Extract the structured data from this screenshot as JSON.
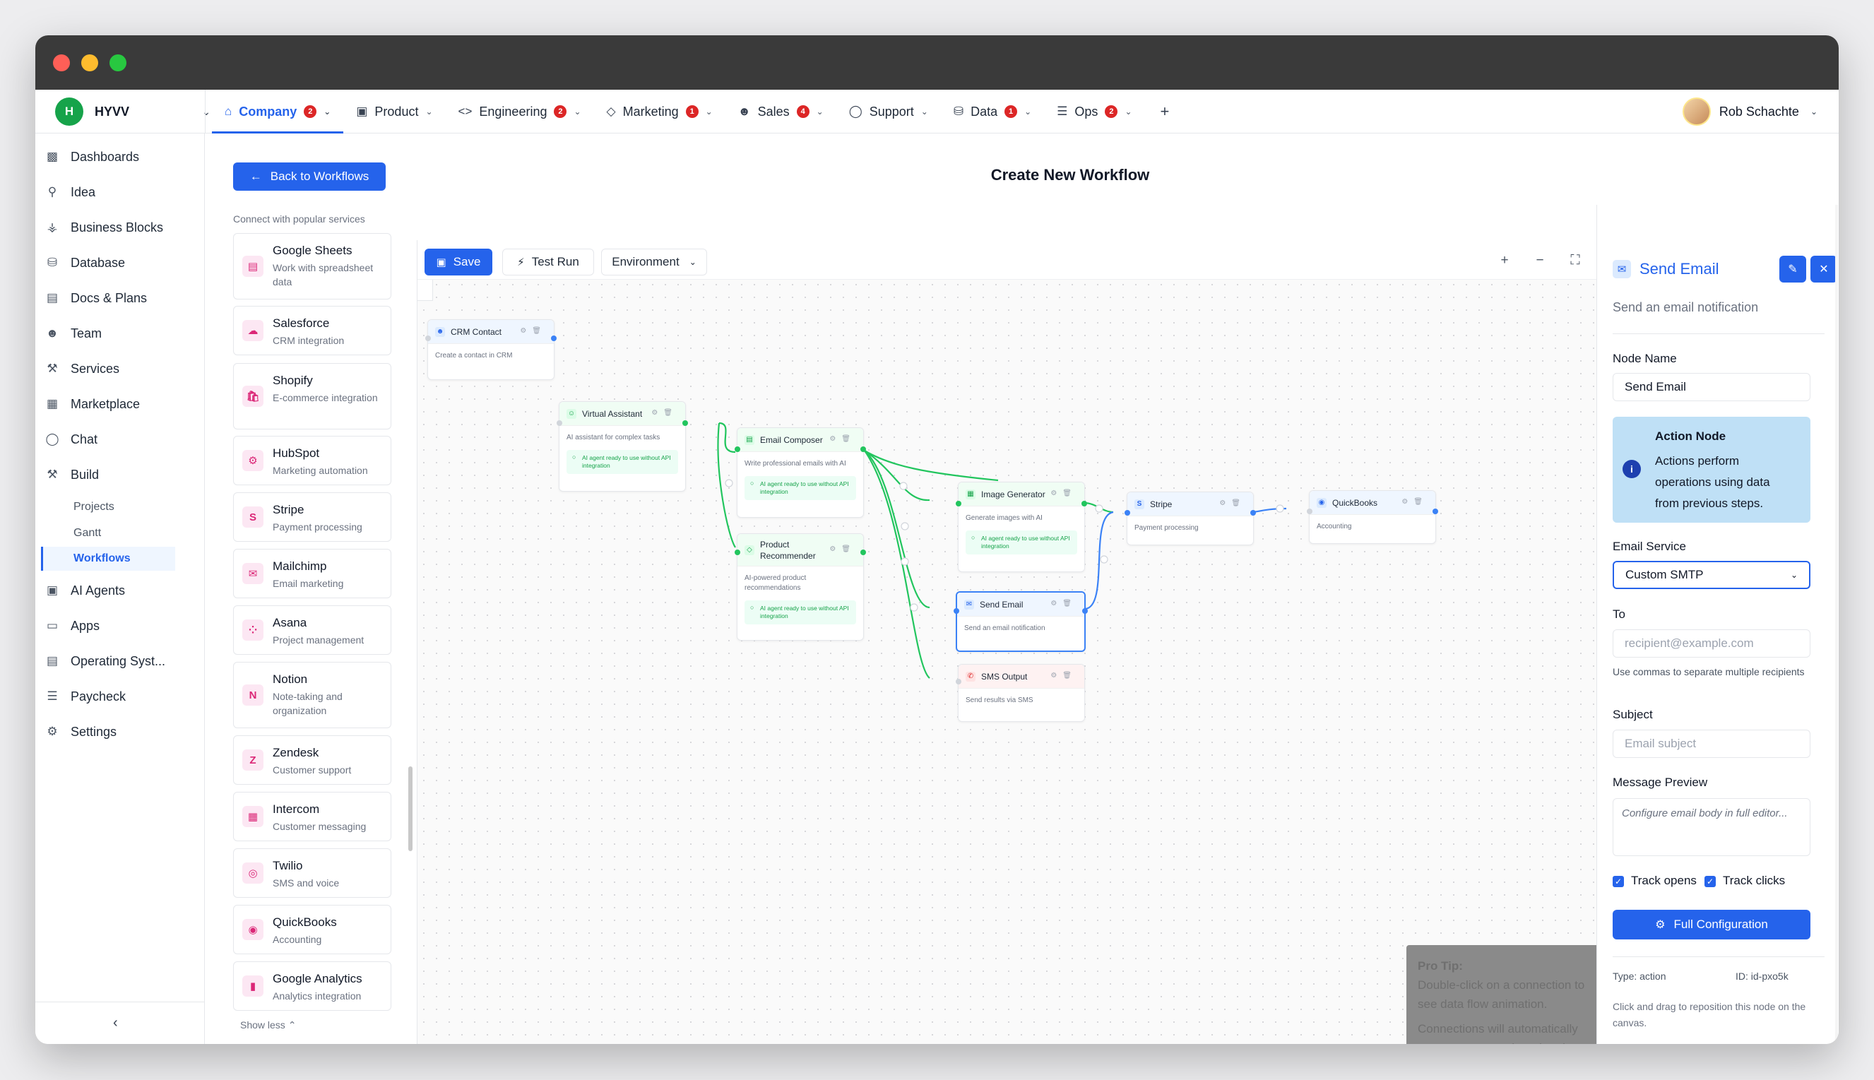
{
  "workspace": {
    "initial": "H",
    "name": "HYVV"
  },
  "tabs": [
    {
      "label": "Company",
      "icon": "home-icon",
      "badge": "2",
      "active": true
    },
    {
      "label": "Product",
      "icon": "box-icon",
      "badge": null
    },
    {
      "label": "Engineering",
      "icon": "code-icon",
      "badge": "2"
    },
    {
      "label": "Marketing",
      "icon": "tag-icon",
      "badge": "1"
    },
    {
      "label": "Sales",
      "icon": "users-icon",
      "badge": "4"
    },
    {
      "label": "Support",
      "icon": "chat-icon",
      "badge": null
    },
    {
      "label": "Data",
      "icon": "database-icon",
      "badge": "1"
    },
    {
      "label": "Ops",
      "icon": "layers-icon",
      "badge": "2"
    }
  ],
  "user": {
    "name": "Rob Schachte"
  },
  "sidebar": {
    "items": [
      {
        "label": "Dashboards",
        "icon": "chart-icon"
      },
      {
        "label": "Idea",
        "icon": "bulb-icon"
      },
      {
        "label": "Business Blocks",
        "icon": "blocks-icon"
      },
      {
        "label": "Database",
        "icon": "database-icon"
      },
      {
        "label": "Docs & Plans",
        "icon": "doc-icon"
      },
      {
        "label": "Team",
        "icon": "team-icon"
      },
      {
        "label": "Services",
        "icon": "wrench-icon"
      },
      {
        "label": "Marketplace",
        "icon": "store-icon"
      },
      {
        "label": "Chat",
        "icon": "chat-icon"
      },
      {
        "label": "Build",
        "icon": "hammer-icon"
      }
    ],
    "build_sub": [
      "Projects",
      "Gantt",
      "Workflows"
    ],
    "items_after": [
      {
        "label": "AI Agents",
        "icon": "robot-icon"
      },
      {
        "label": "Apps",
        "icon": "window-icon"
      },
      {
        "label": "Operating Syst...",
        "icon": "server-icon"
      },
      {
        "label": "Paycheck",
        "icon": "layers-icon"
      },
      {
        "label": "Settings",
        "icon": "gear-icon"
      }
    ]
  },
  "header": {
    "back_label": "Back to Workflows",
    "title": "Create New Workflow"
  },
  "services": {
    "label": "Connect with popular services",
    "items": [
      {
        "name": "Google Sheets",
        "desc": "Work with spreadsheet data",
        "glyph": "▤"
      },
      {
        "name": "Salesforce",
        "desc": "CRM integration",
        "glyph": "☁"
      },
      {
        "name": "Shopify",
        "desc": "E-commerce integration",
        "glyph": "🛍"
      },
      {
        "name": "HubSpot",
        "desc": "Marketing automation",
        "glyph": "⚙"
      },
      {
        "name": "Stripe",
        "desc": "Payment processing",
        "glyph": "S"
      },
      {
        "name": "Mailchimp",
        "desc": "Email marketing",
        "glyph": "✉"
      },
      {
        "name": "Asana",
        "desc": "Project management",
        "glyph": "⁘"
      },
      {
        "name": "Notion",
        "desc": "Note-taking and organization",
        "glyph": "N"
      },
      {
        "name": "Zendesk",
        "desc": "Customer support",
        "glyph": "Z"
      },
      {
        "name": "Intercom",
        "desc": "Customer messaging",
        "glyph": "▦"
      },
      {
        "name": "Twilio",
        "desc": "SMS and voice",
        "glyph": "◎"
      },
      {
        "name": "QuickBooks",
        "desc": "Accounting",
        "glyph": "◉"
      },
      {
        "name": "Google Analytics",
        "desc": "Analytics integration",
        "glyph": "▮"
      }
    ],
    "show_less": "Show less"
  },
  "toolbar": {
    "save": "Save",
    "test_run": "Test Run",
    "environment": "Environment"
  },
  "nodes": {
    "crm": {
      "title": "CRM Contact",
      "desc": "Create a contact in CRM"
    },
    "va": {
      "title": "Virtual Assistant",
      "desc": "AI assistant for complex tasks",
      "ai": "AI agent ready to use without API integration"
    },
    "ec": {
      "title": "Email Composer",
      "desc": "Write professional emails with AI",
      "ai": "AI agent ready to use without API integration"
    },
    "pr": {
      "title": "Product Recommender",
      "desc": "AI-powered product recommendations",
      "ai": "AI agent ready to use without API integration"
    },
    "ig": {
      "title": "Image Generator",
      "desc": "Generate images with AI",
      "ai": "AI agent ready to use without API integration"
    },
    "se": {
      "title": "Send Email",
      "desc": "Send an email notification"
    },
    "sms": {
      "title": "SMS Output",
      "desc": "Send results via SMS"
    },
    "stripe": {
      "title": "Stripe",
      "desc": "Payment processing"
    },
    "qb": {
      "title": "QuickBooks",
      "desc": "Accounting"
    }
  },
  "tip": {
    "title": "Pro Tip:",
    "line1": "Double-click on a connection to see data flow animation.",
    "line2": "Connections will automatically snap to target nodes when in range."
  },
  "panel": {
    "title": "Send Email",
    "subtitle": "Send an email notification",
    "node_name_label": "Node Name",
    "node_name_value": "Send Email",
    "info_title": "Action Node",
    "info_text": "Actions perform operations using data from previous steps.",
    "email_service_label": "Email Service",
    "email_service_value": "Custom SMTP",
    "to_label": "To",
    "to_placeholder": "recipient@example.com",
    "to_hint": "Use commas to separate multiple recipients",
    "subject_label": "Subject",
    "subject_placeholder": "Email subject",
    "preview_label": "Message Preview",
    "preview_placeholder": "Configure email body in full editor...",
    "track_opens": "Track opens",
    "track_clicks": "Track clicks",
    "full_config": "Full Configuration",
    "type": "Type: action",
    "id": "ID: id-pxo5k",
    "help": "Click and drag to reposition this node on the canvas."
  }
}
